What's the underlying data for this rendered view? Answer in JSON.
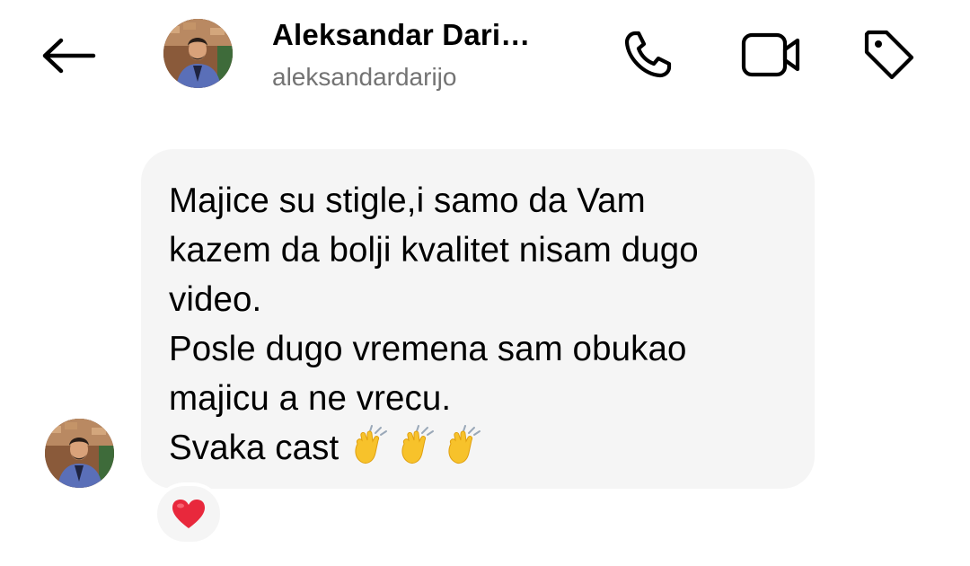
{
  "header": {
    "back_label": "back",
    "name": "Aleksandar Dari…",
    "username": "aleksandardarijo",
    "icons": [
      "back-arrow-icon",
      "phone-icon",
      "video-camera-icon",
      "tag-icon"
    ]
  },
  "message": {
    "lines": [
      "Majice su stigle,i samo da Vam",
      "kazem da bolji kvalitet nisam dugo",
      "video.",
      "Posle dugo vremena sam obukao",
      "majicu a ne vrecu.",
      "Svaka cast"
    ],
    "emoji": [
      "clapping-hands-icon",
      "clapping-hands-icon",
      "clapping-hands-icon"
    ]
  },
  "reaction": {
    "icon": "red-heart-icon",
    "color": "#e0245e"
  },
  "colors": {
    "bubble": "#f5f5f5",
    "username": "#737373",
    "icon_stroke": "#000000"
  }
}
